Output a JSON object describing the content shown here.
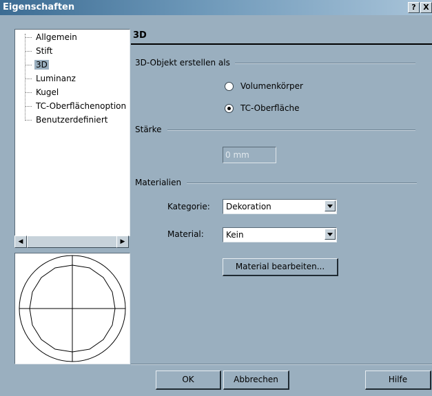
{
  "window": {
    "title": "Eigenschaften",
    "help_label": "?",
    "close_label": "X"
  },
  "tree": {
    "items": [
      {
        "label": "Allgemein",
        "selected": false
      },
      {
        "label": "Stift",
        "selected": false
      },
      {
        "label": "3D",
        "selected": true
      },
      {
        "label": "Luminanz",
        "selected": false
      },
      {
        "label": "Kugel",
        "selected": false
      },
      {
        "label": "TC-Oberflächenoption",
        "selected": false
      },
      {
        "label": "Benutzerdefiniert",
        "selected": false
      }
    ]
  },
  "scrollbar": {
    "left_arrow": "◀",
    "right_arrow": "▶"
  },
  "pane": {
    "title": "3D",
    "create_as": {
      "label": "3D-Objekt erstellen als",
      "options": [
        {
          "label": "Volumenkörper",
          "checked": false
        },
        {
          "label": "TC-Oberfläche",
          "checked": true
        }
      ]
    },
    "thickness": {
      "label": "Stärke",
      "value": "0 mm"
    },
    "materials": {
      "label": "Materialien",
      "category_label": "Kategorie:",
      "category_value": "Dekoration",
      "material_label": "Material:",
      "material_value": "Kein",
      "edit_button": "Material bearbeiten..."
    }
  },
  "footer": {
    "ok": "OK",
    "cancel": "Abbrechen",
    "help": "Hilfe"
  }
}
